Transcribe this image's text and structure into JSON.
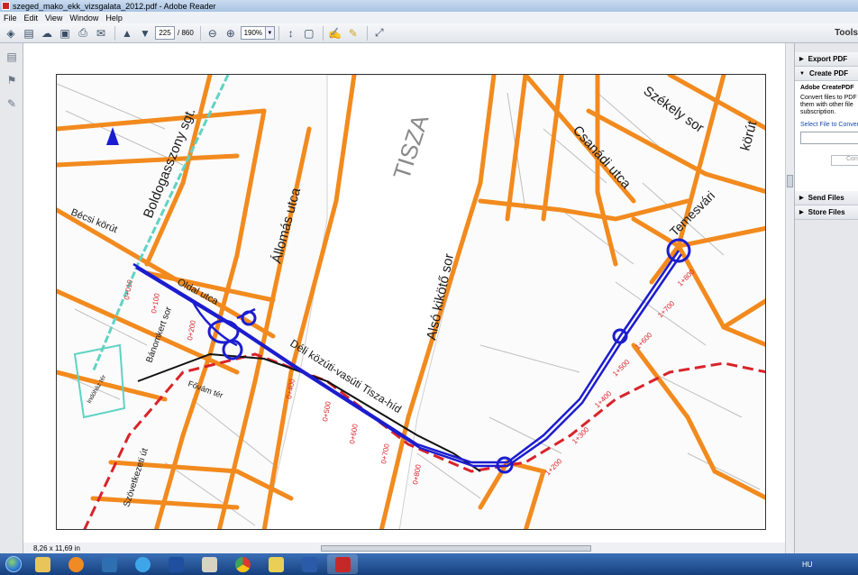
{
  "window": {
    "title": "szeged_mako_ekk_vizsgalata_2012.pdf - Adobe Reader"
  },
  "menu": [
    "File",
    "Edit",
    "View",
    "Window",
    "Help"
  ],
  "toolbar": {
    "page_current": "225",
    "page_total": "/ 860",
    "zoom": "190%",
    "tools_label": "Tools"
  },
  "status": {
    "page_size": "8,26 x 11,69 in"
  },
  "right_panel": {
    "export_pdf": "Export PDF",
    "create_pdf": "Create PDF",
    "create_title": "Adobe CreatePDF",
    "create_desc_1": "Convert files to PDF",
    "create_desc_2": "them with other file",
    "create_desc_3": "subscription.",
    "select_file": "Select File to Conver",
    "convert": "Con",
    "send_files": "Send Files",
    "store_files": "Store Files"
  },
  "map": {
    "street_labels": {
      "boldogasszony": "Boldogasszony sgt.",
      "becsi": "Bécsi körút",
      "allomas": "Állomás utca",
      "tisza": "TISZA",
      "also_kikoto": "Alsó kikötő sor",
      "csanadi": "Csanádi utca",
      "szekely": "Székely sor",
      "korut": "körút",
      "temesvari": "Temesvári",
      "oldal": "Oldal utca",
      "banomkert": "Bánomkert sor",
      "deli_hid": "Déli közúti-vasúti Tisza-híd",
      "fovam": "Fővám tér",
      "szovetkezeti": "Szövetkezeti út",
      "csatorna": "Indóház tér"
    },
    "chainage_labels": [
      "0+010",
      "0+100",
      "0+200",
      "0+400",
      "0+500",
      "0+600",
      "0+700",
      "0+800",
      "1+200",
      "1+300",
      "1+400",
      "1+500",
      "1+600",
      "1+700",
      "1+800"
    ]
  },
  "colors": {
    "road_orange": "#f28a1e",
    "route_blue": "#1c1ccf",
    "rail_red": "#d9232a",
    "tram_teal": "#5fd3c3"
  },
  "taskbar": {
    "clock": "HU"
  }
}
